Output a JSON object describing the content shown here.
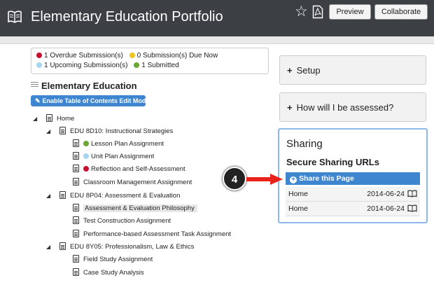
{
  "header": {
    "title": "Elementary Education Portfolio",
    "preview_label": "Preview",
    "collaborate_label": "Collaborate",
    "icons": [
      "book-icon",
      "star-icon",
      "pdf-icon"
    ]
  },
  "status": {
    "overdue": "1 Overdue Submission(s)",
    "due_now": "0 Submission(s) Due Now",
    "upcoming": "1 Upcoming Submission(s)",
    "submitted": "1 Submitted",
    "colors": {
      "overdue": "#c8102e",
      "due_now": "#f0c419",
      "upcoming": "#a6d5f2",
      "submitted": "#6aa832"
    }
  },
  "toc": {
    "title": "Elementary Education",
    "edit_label": "Enable Table of Contents Edit Mode",
    "home": "Home",
    "groups": [
      {
        "label": "EDU 8D10: Instructional Strategies",
        "items": [
          {
            "label": "Lesson Plan Assignment",
            "status": "submitted"
          },
          {
            "label": "Unit Plan Assignment",
            "status": "upcoming"
          },
          {
            "label": "Reflection and Self-Assessment",
            "status": "overdue"
          },
          {
            "label": "Classroom Management Assignment",
            "status": ""
          }
        ]
      },
      {
        "label": "EDU 8P04: Assessment & Evaluation",
        "items": [
          {
            "label": "Assessment & Evaluation Philosophy",
            "status": "",
            "selected": true
          },
          {
            "label": "Test Construction Assignment",
            "status": ""
          },
          {
            "label": "Performance-based Assessment Task Assignment",
            "status": ""
          }
        ]
      },
      {
        "label": "EDU 8Y05: Professionalism, Law & Ethics",
        "items": [
          {
            "label": "Field Study Assignment",
            "status": ""
          },
          {
            "label": "Case Study Analysis",
            "status": ""
          }
        ]
      }
    ]
  },
  "panels": {
    "setup": "Setup",
    "assessed": "How will I be assessed?"
  },
  "sharing": {
    "title": "Sharing",
    "subtitle": "Secure Sharing URLs",
    "share_label": "Share this Page",
    "rows": [
      {
        "page": "Home",
        "date": "2014-06-24"
      },
      {
        "page": "Home",
        "date": "2014-06-24"
      }
    ]
  },
  "callout": {
    "number": "4",
    "color": "#e8211b"
  }
}
